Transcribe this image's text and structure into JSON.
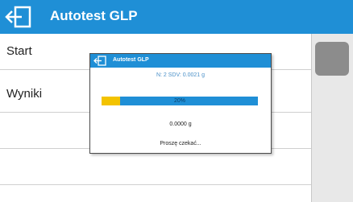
{
  "header": {
    "title": "Autotest GLP",
    "back_icon": "exit-icon",
    "color": "#1f8fd6"
  },
  "list": {
    "items": [
      "Start",
      "Wyniki",
      "",
      "",
      ""
    ]
  },
  "dialog": {
    "title": "Autotest GLP",
    "back_icon": "exit-icon",
    "info": "N:  2   SDV: 0.0021 g",
    "progress": {
      "fraction": 0.2,
      "label": "20%"
    },
    "value": "0.0000 g",
    "status": "Proszę czekać..."
  },
  "colors": {
    "accent": "#1f8fd6",
    "progress_fill": "#f3c300",
    "scroll_thumb": "#8c8c8c"
  }
}
